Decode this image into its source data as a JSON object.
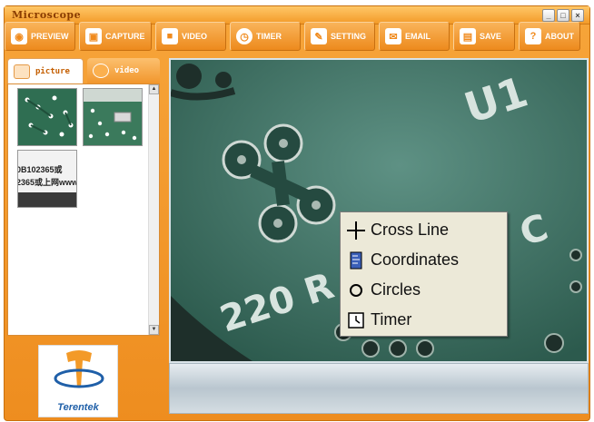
{
  "window": {
    "title": "Microscope"
  },
  "toolbar": {
    "buttons": [
      {
        "label": "PREVIEW",
        "icon": "eye-icon"
      },
      {
        "label": "CAPTURE",
        "icon": "camera-icon"
      },
      {
        "label": "VIDEO",
        "icon": "video-camera-icon"
      },
      {
        "label": "TIMER",
        "icon": "clock-icon"
      },
      {
        "label": "SETTING",
        "icon": "wrench-icon"
      },
      {
        "label": "EMAIL",
        "icon": "envelope-icon"
      },
      {
        "label": "SAVE",
        "icon": "floppy-disk-icon"
      },
      {
        "label": "ABOUT",
        "icon": "question-mark-icon"
      }
    ]
  },
  "tabs": [
    {
      "label": "picture",
      "active": true
    },
    {
      "label": "video",
      "active": false
    }
  ],
  "thumbnails": [
    {
      "subject": "green circuit board close-up"
    },
    {
      "subject": "circuit board with chip pins"
    },
    {
      "subject": "printed text",
      "text_line1": "0B102365或",
      "text_line2": "2365或上网www."
    }
  ],
  "context_menu": {
    "items": [
      {
        "label": "Cross Line",
        "icon": "crosshair-icon"
      },
      {
        "label": "Coordinates",
        "icon": "ruler-icon"
      },
      {
        "label": "Circles",
        "icon": "circle-icon"
      },
      {
        "label": "Timer",
        "icon": "clock-icon"
      }
    ]
  },
  "logo": {
    "text": "Terentek"
  },
  "colors": {
    "frame": "#ee8d1f",
    "board": "#3f6f63",
    "menu": "#ece9d8"
  }
}
